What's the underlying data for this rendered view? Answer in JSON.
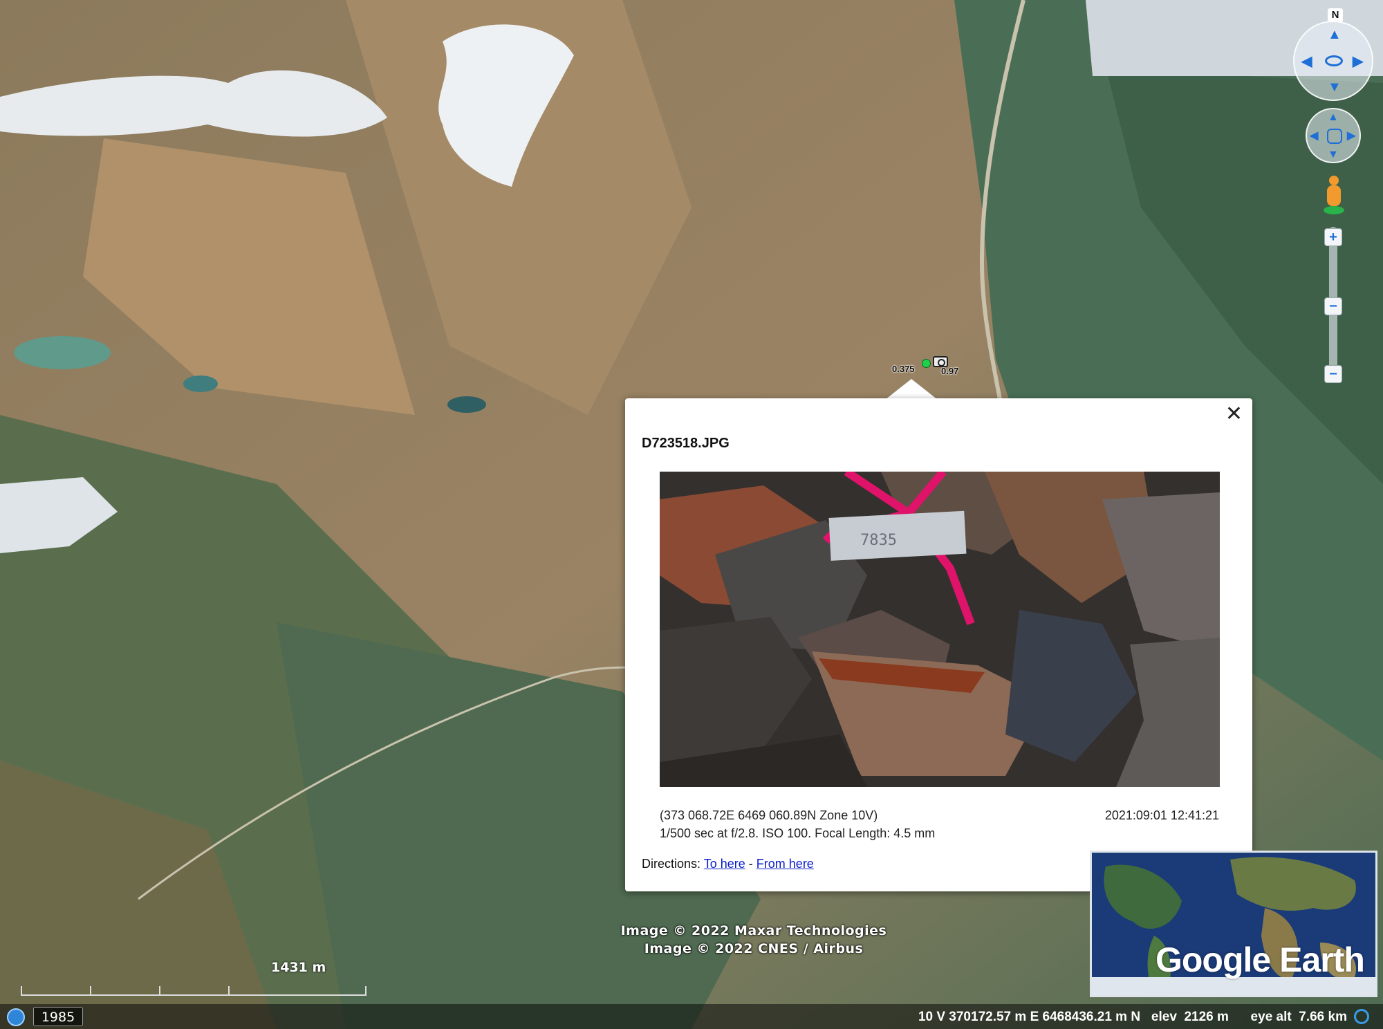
{
  "map": {
    "placemark_labels": [
      "0.375",
      "0.97"
    ],
    "attribution": [
      "Image © 2022 Maxar Technologies",
      "Image © 2022 CNES / Airbus"
    ],
    "scale_label": "1431 m",
    "year": "1985",
    "north_label": "N",
    "logo": "Google Earth"
  },
  "balloon": {
    "title": "D723518.JPG",
    "coords": "(373 068.72E 6469 060.89N Zone 10V)",
    "exposure": "1/500 sec at f/2.8. ISO 100. Focal Length: 4.5 mm",
    "datetime": "2021:09:01 12:41:21",
    "directions_label": "Directions:",
    "to_here": "To here",
    "separator": "-",
    "from_here": "From here",
    "close_symbol": "✕",
    "tag_text": "7835"
  },
  "status": {
    "text": "10 V 370172.57 m E 6468436.21 m N   elev  2126 m      eye alt  7.66 km"
  },
  "controls": {
    "zoom_in": "+",
    "zoom_out": "−"
  },
  "colors": {
    "link": "#0a1ccc",
    "placemark_green": "#1fd14a",
    "nav_accent": "#1e6fd6"
  }
}
